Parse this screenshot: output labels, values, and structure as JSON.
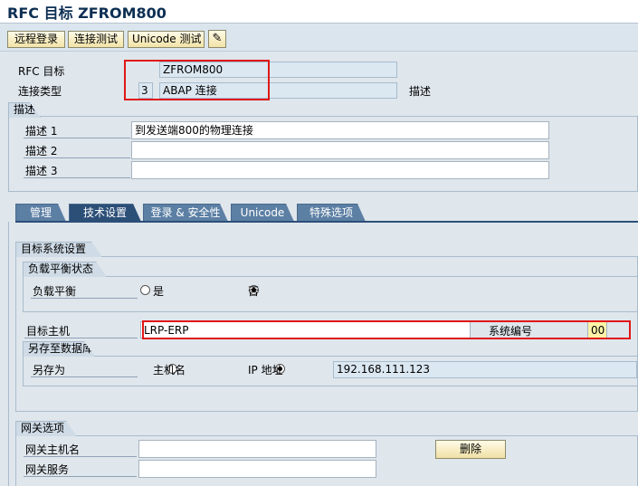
{
  "window": {
    "title": "RFC 目标 ZFROM800"
  },
  "toolbar": {
    "remote_logon": "远程登录",
    "connection_test": "连接测试",
    "unicode_test": "Unicode 测试",
    "edit_icon": "pencil-icon"
  },
  "header": {
    "rfc_dest_label": "RFC 目标",
    "rfc_dest_value": "ZFROM800",
    "conn_type_label": "连接类型",
    "conn_type_code": "3",
    "conn_type_value": "ABAP 连接",
    "desc_label": "描述"
  },
  "description": {
    "section_title": "描述",
    "desc1_label": "描述 1",
    "desc1_value": "到发送端800的物理连接",
    "desc2_label": "描述 2",
    "desc2_value": "",
    "desc3_label": "描述 3",
    "desc3_value": ""
  },
  "tabs": [
    {
      "label": "管理"
    },
    {
      "label": "技术设置"
    },
    {
      "label": "登录 & 安全性"
    },
    {
      "label": "Unicode"
    },
    {
      "label": "特殊选项"
    }
  ],
  "target_system": {
    "section_title": "目标系统设置",
    "load_balance_title": "负载平衡状态",
    "load_balance_label": "负载平衡",
    "yes_label": "是",
    "no_label": "否",
    "load_balance_selected": "no",
    "target_host_label": "目标主机",
    "target_host_value": "LRP-ERP",
    "system_number_label": "系统编号",
    "system_number_value": "00",
    "save_db_title": "另存至数据库",
    "save_as_label": "另存为",
    "hostname_label": "主机名",
    "ip_label": "IP 地址",
    "save_as_selected": "ip",
    "ip_value": "192.168.111.123"
  },
  "gateway": {
    "section_title": "网关选项",
    "host_label": "网关主机名",
    "host_value": "",
    "service_label": "网关服务",
    "service_value": "",
    "delete_label": "删除"
  }
}
